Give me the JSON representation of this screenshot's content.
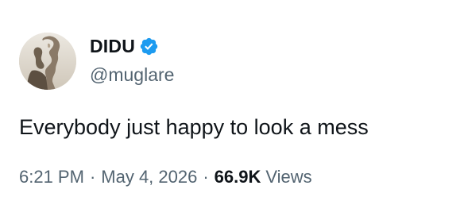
{
  "author": {
    "display_name": "DIDU",
    "handle": "@muglare",
    "verified": true,
    "verified_color": "#1d9bf0"
  },
  "tweet": {
    "text": "Everybody just happy to look a mess"
  },
  "meta": {
    "time": "6:21 PM",
    "separator": "·",
    "date": "May 4, 2026",
    "views_count": "66.9K",
    "views_label": "Views"
  },
  "icons": {
    "verified": "verified-badge-icon",
    "avatar": "avatar-image"
  }
}
